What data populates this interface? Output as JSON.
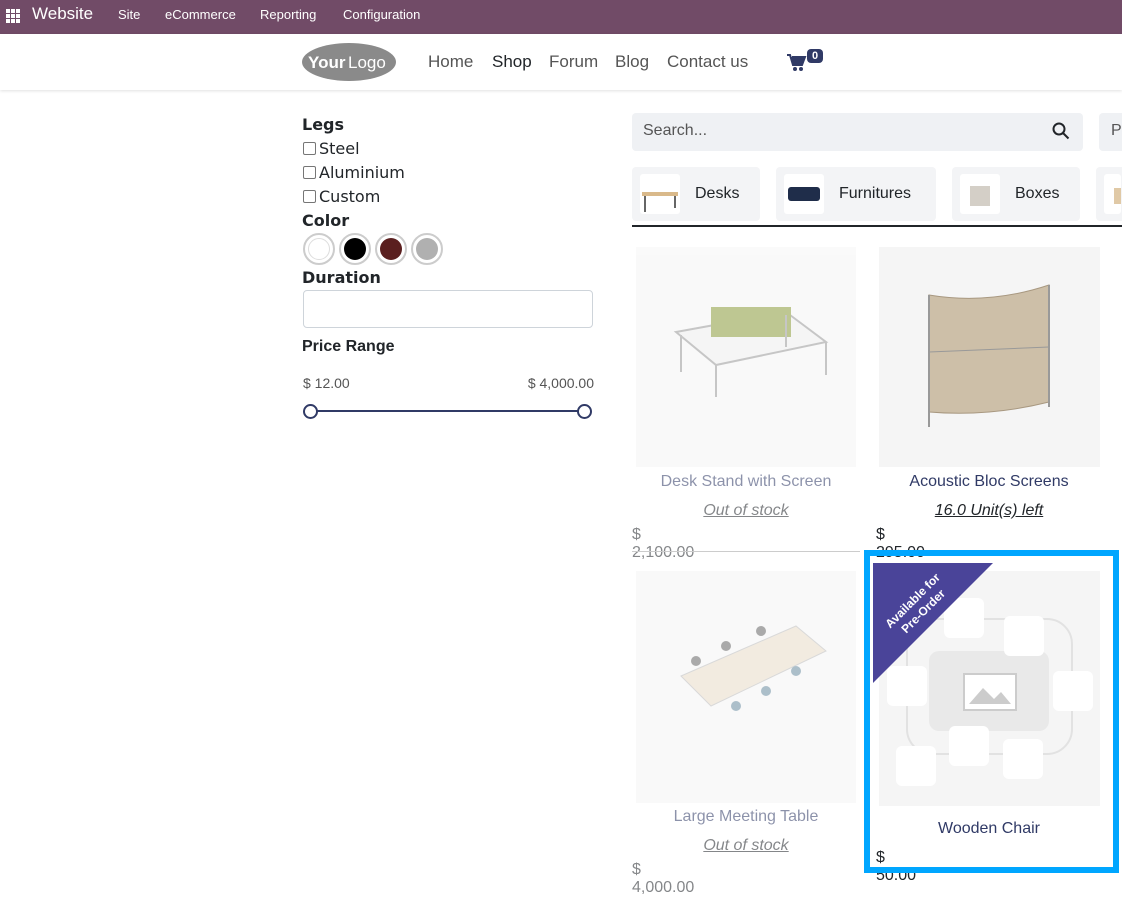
{
  "admin": {
    "brand": "Website",
    "menu": [
      "Site",
      "eCommerce",
      "Reporting",
      "Configuration"
    ]
  },
  "nav": {
    "logo_text": "YourLogo",
    "links": [
      "Home",
      "Shop",
      "Forum",
      "Blog",
      "Contact us"
    ],
    "active": "Shop",
    "cart_count": "0"
  },
  "filters": {
    "legs": {
      "title": "Legs",
      "options": [
        "Steel",
        "Aluminium",
        "Custom"
      ]
    },
    "color": {
      "title": "Color",
      "swatches": [
        "#ffffff",
        "#000000",
        "#5a1f1f",
        "#b0b0b0"
      ]
    },
    "duration": {
      "title": "Duration",
      "value": ""
    },
    "price": {
      "title": "Price Range",
      "min": "$ 12.00",
      "max": "$ 4,000.00"
    }
  },
  "search": {
    "placeholder": "Search...",
    "sort_label": "P"
  },
  "categories": [
    "Desks",
    "Furnitures",
    "Boxes"
  ],
  "products": [
    {
      "name": "Desk Stand with Screen",
      "stock": "Out of stock",
      "price": "$ 2,100.00"
    },
    {
      "name": "Acoustic Bloc Screens",
      "stock": "16.0 Unit(s) left",
      "price": "$ 295.00"
    },
    {
      "name": "Large Meeting Table",
      "stock": "Out of stock",
      "price": "$ 4,000.00"
    },
    {
      "name": "Wooden Chair",
      "ribbon": "Available for Pre-Order",
      "price": "$ 50.00"
    }
  ],
  "colors": {
    "admin_bar": "#714b67",
    "primary": "#303a66",
    "highlight": "#00a6ff",
    "ribbon": "#4a4499"
  }
}
